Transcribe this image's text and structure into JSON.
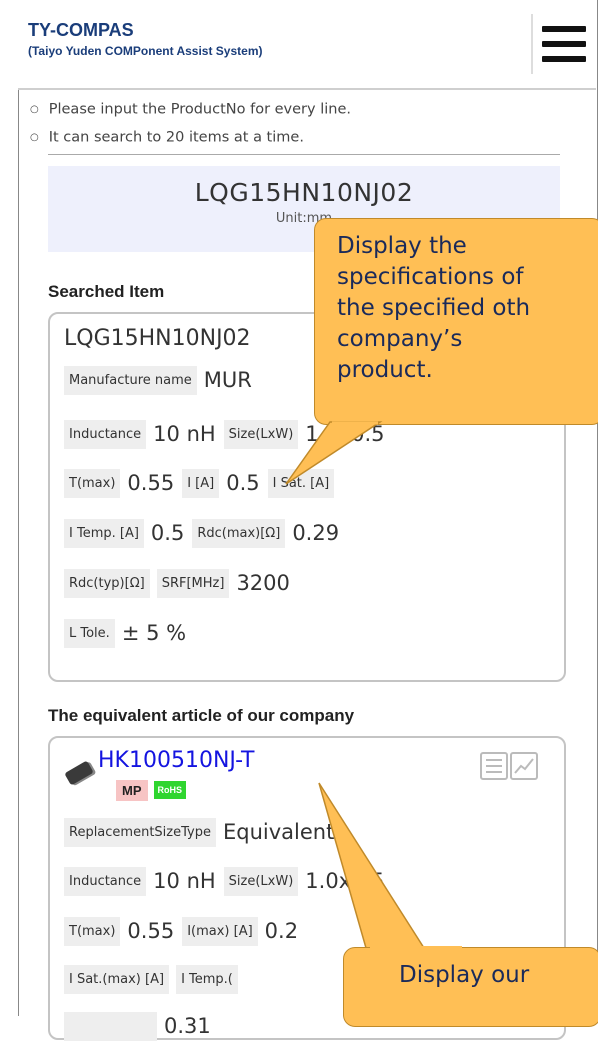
{
  "header": {
    "title": "TY-COMPAS",
    "subtitle": "(Taiyo Yuden COMPonent Assist System)",
    "menu_icon": "hamburger-menu-icon"
  },
  "notes": [
    "Please input the ProductNo for every line.",
    "It can search to 20 items at a time."
  ],
  "search_result": {
    "product_no": "LQG15HN10NJ02",
    "unit": "Unit:mm"
  },
  "searched_item": {
    "heading": "Searched Item",
    "title": "LQG15HN10NJ02",
    "manufacturer_label": "Manufacture name",
    "manufacturer_value": "MUR",
    "inductance_label": "Inductance",
    "inductance_value": "10 nH",
    "size_label": "Size(LxW)",
    "size_value": "1.0x0.5",
    "tmax_label": "T(max)",
    "tmax_value": "0.55",
    "ia_label": "I [A]",
    "ia_value": "0.5",
    "isat_label": "I Sat. [A]",
    "itemp_label": "I Temp. [A]",
    "itemp_value": "0.5",
    "rdcmax_label": "Rdc(max)[Ω]",
    "rdcmax_value": "0.29",
    "rdctyp_label": "Rdc(typ)[Ω]",
    "srf_label": "SRF[MHz]",
    "srf_value": "3200",
    "ltole_label": "L Tole.",
    "ltole_value": "± 5 %"
  },
  "equivalent": {
    "heading": "The equivalent article of our company",
    "title": "HK100510NJ-T",
    "badge_mp": "MP",
    "badge_rohs": "RoHS",
    "product_icon": "inductor-chip-icon",
    "list_icon": "list-icon",
    "chart_icon": "chart-icon",
    "replacement_label": "ReplacementSizeType",
    "replacement_value": "Equivalent",
    "inductance_label": "Inductance",
    "inductance_value": "10 nH",
    "size_label": "Size(LxW)",
    "size_value": "1.0x0.5",
    "tmax_label": "T(max)",
    "tmax_value": "0.55",
    "imax_label": "I(max) [A]",
    "imax_value": "0.2",
    "isatmax_label": "I Sat.(max) [A]",
    "itemp_label": "I Temp.(",
    "row4_value": "0.31"
  },
  "callouts": {
    "top": [
      "Display the",
      "specifications of",
      "the specified oth",
      "company’s",
      "product."
    ],
    "bottom": "Display our"
  },
  "colors": {
    "callout": "#ffbf55",
    "link": "#1414e0",
    "brand": "#1a3d7a",
    "label_bg": "#eeeeee",
    "result_bg": "#eef0fc"
  }
}
